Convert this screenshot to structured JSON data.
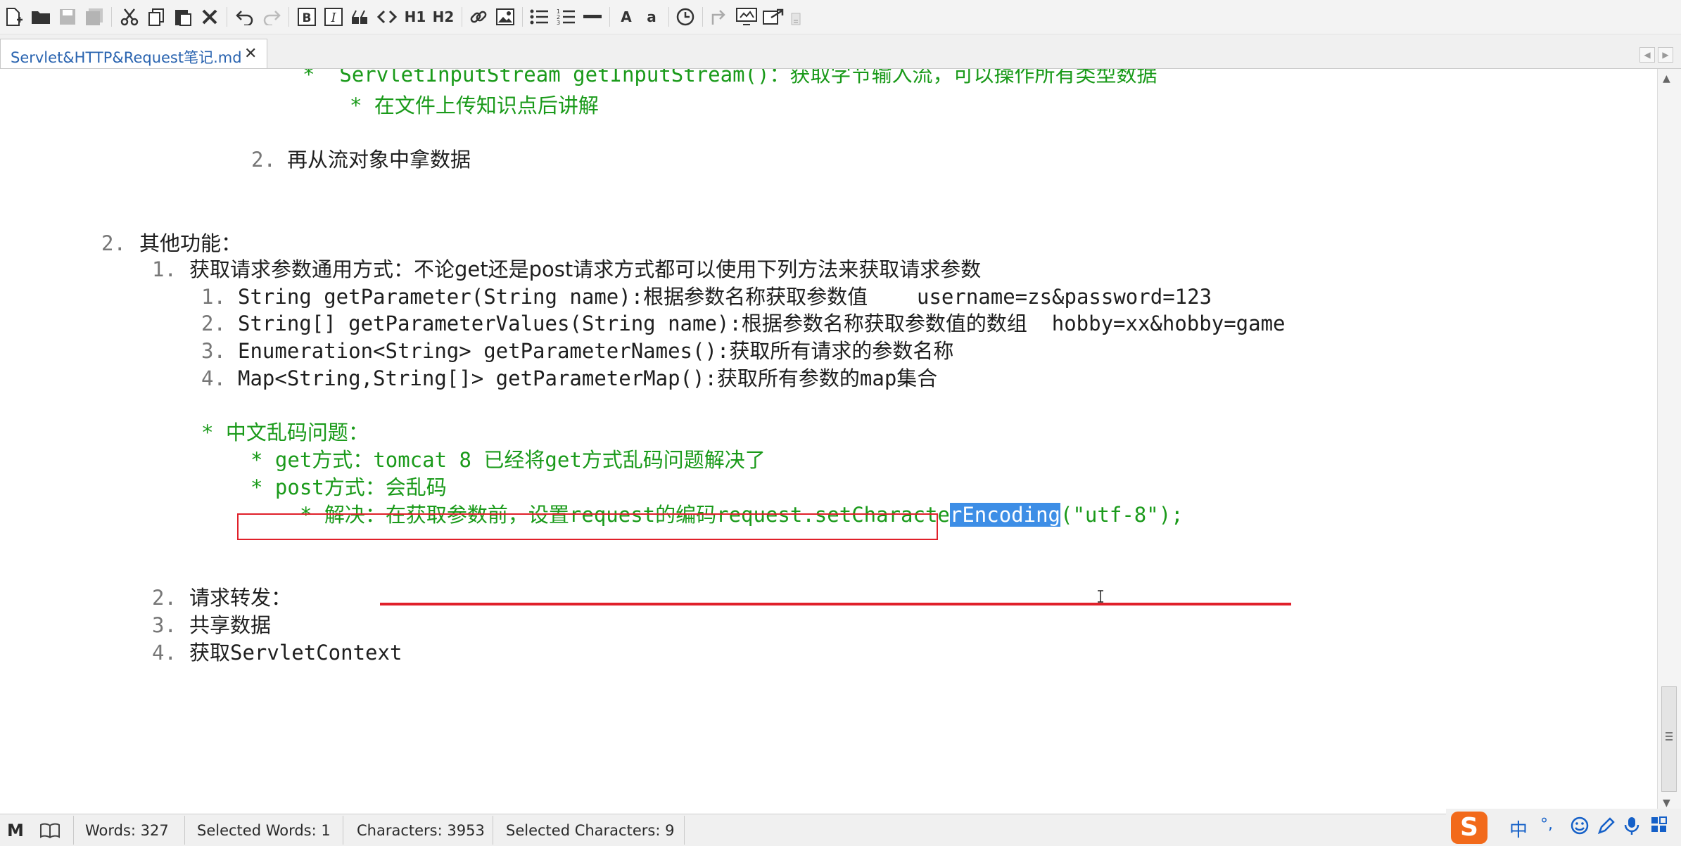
{
  "toolbar": {
    "icons": [
      "new-file-icon",
      "open-folder-icon",
      "save-icon",
      "save-all-icon",
      "cut-icon",
      "copy-icon",
      "paste-icon",
      "delete-icon",
      "undo-icon",
      "redo-icon",
      "bold-icon",
      "italic-icon",
      "quote-icon",
      "code-icon",
      "h1-icon",
      "h2-icon",
      "link-icon",
      "image-icon",
      "bullet-list-icon",
      "numbered-list-icon",
      "horizontal-rule-icon",
      "uppercase-icon",
      "lowercase-icon",
      "timestamp-icon",
      "export-icon",
      "preview-icon",
      "publish-icon"
    ],
    "h1": "H1",
    "h2": "H2",
    "upper": "A",
    "lower": "a"
  },
  "tab": {
    "title": "Servlet&HTTP&Request笔记.md",
    "close": "✕"
  },
  "nav": {
    "left": "◀",
    "right": "▶"
  },
  "editor": {
    "l1": "*  ServletInputStream getInputStream()：获取字节输入流，可以操作所有类型数据",
    "l2": "* 在文件上传知识点后讲解",
    "l3_num": "2.",
    "l3": "再从流对象中拿数据",
    "l4_num": "2.",
    "l4": "其他功能：",
    "l5_num": "1.",
    "l5": "获取请求参数通用方式：不论get还是post请求方式都可以使用下列方法来获取请求参数",
    "l6_num": "1.",
    "l6": "String getParameter(String name):根据参数名称获取参数值    username=zs&password=123",
    "l7_num": "2.",
    "l7": "String[] getParameterValues(String name):根据参数名称获取参数值的数组  hobby=xx&hobby=game",
    "l8_num": "3.",
    "l8": "Enumeration<String> getParameterNames():获取所有请求的参数名称",
    "l9_num": "4.",
    "l9": "Map<String,String[]> getParameterMap():获取所有参数的map集合",
    "l10": "* 中文乱码问题：",
    "l11": "* get方式：tomcat 8 已经将get方式乱码问题解决了",
    "l12": "* post方式：会乱码",
    "l13_a": "* 解决：在获取参数前，设置request的编码request.setCharacte",
    "l13_sel": "rEncoding",
    "l13_b": "(\"utf-8\");",
    "l14_num": "2.",
    "l14": "请求转发：",
    "l15_num": "3.",
    "l15": "共享数据",
    "l16_num": "4.",
    "l16": "获取ServletContext"
  },
  "status": {
    "mode_icon": "M",
    "words": "Words: 327",
    "selected_words": "Selected Words: 1",
    "characters": "Characters: 3953",
    "selected_characters": "Selected Characters: 9"
  },
  "ime": {
    "logo": "S",
    "lang": "中",
    "punct": "°,"
  },
  "colors": {
    "text_green": "#1a9a1a",
    "selection": "#3d8ee6",
    "annotation_red": "#e0202a",
    "tab_title": "#2a64b0"
  }
}
